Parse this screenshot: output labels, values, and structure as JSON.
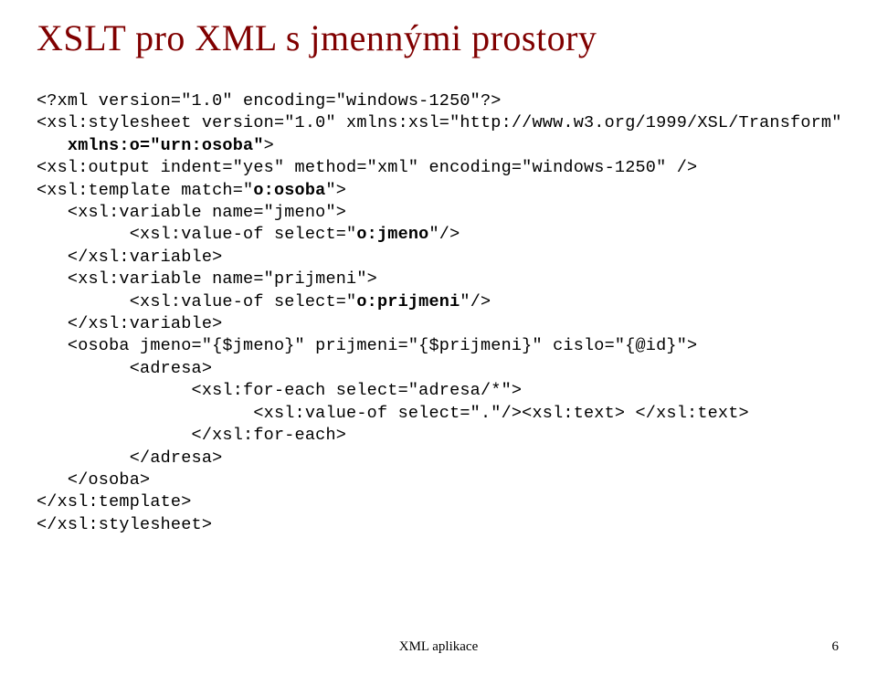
{
  "title": "XSLT pro XML s jmennými prostory",
  "code": {
    "l01": "<?xml version=\"1.0\" encoding=\"windows-1250\"?>",
    "l02": "<xsl:stylesheet version=\"1.0\" xmlns:xsl=\"http://www.w3.org/1999/XSL/Transform\"",
    "l03a": "   ",
    "l03b": "xmlns:o=\"urn:osoba\"",
    "l03c": ">",
    "l04": "<xsl:output indent=\"yes\" method=\"xml\" encoding=\"windows-1250\" />",
    "l05a": "<xsl:template match=\"",
    "l05b": "o:osoba",
    "l05c": "\">",
    "l06": "   <xsl:variable name=\"jmeno\">",
    "l07a": "         <xsl:value-of select=\"",
    "l07b": "o:jmeno",
    "l07c": "\"/>",
    "l08": "   </xsl:variable>",
    "l09": "   <xsl:variable name=\"prijmeni\">",
    "l10a": "         <xsl:value-of select=\"",
    "l10b": "o:prijmeni",
    "l10c": "\"/>",
    "l11": "   </xsl:variable>",
    "l12": "   <osoba jmeno=\"{$jmeno}\" prijmeni=\"{$prijmeni}\" cislo=\"{@id}\">",
    "l13": "         <adresa>",
    "l14": "               <xsl:for-each select=\"adresa/*\">",
    "l15": "                     <xsl:value-of select=\".\"/><xsl:text> </xsl:text>",
    "l16": "               </xsl:for-each>",
    "l17": "         </adresa>",
    "l18": "   </osoba>",
    "l19": "</xsl:template>",
    "l20": "</xsl:stylesheet>"
  },
  "footer": "XML aplikace",
  "pagenum": "6"
}
